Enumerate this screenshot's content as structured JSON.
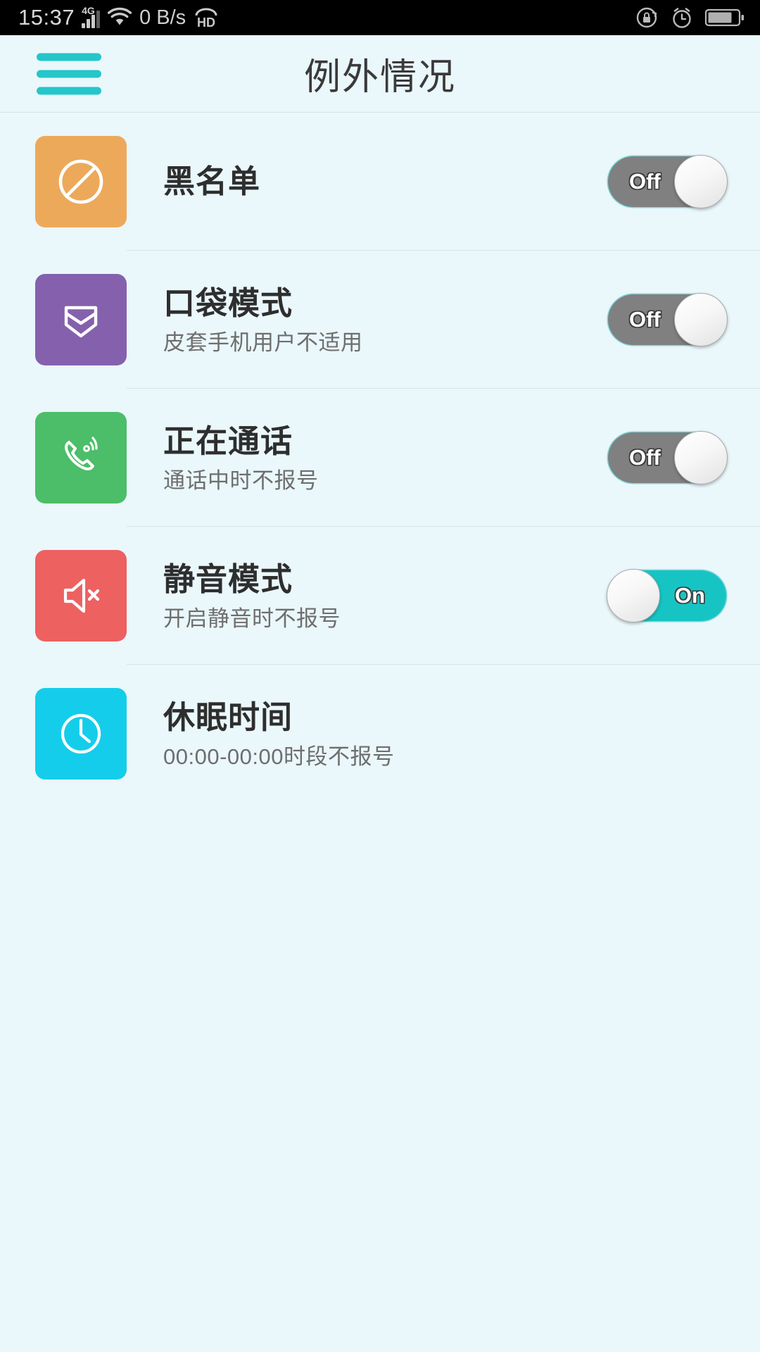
{
  "status_bar": {
    "time": "15:37",
    "network_type": "4G",
    "data_rate": "0 B/s",
    "icons": [
      "signal-icon",
      "wifi-icon",
      "hd-icon",
      "rotation-lock-icon",
      "alarm-icon",
      "battery-icon"
    ],
    "background": "#000000",
    "foreground": "#c8c8c8"
  },
  "header": {
    "menu_label": "menu",
    "title": "例外情况",
    "accent_color": "#24c6c9",
    "background": "#eaf7fb"
  },
  "theme": {
    "page_background": "#eaf7fb",
    "divider": "#d9e3e6",
    "toggle_on": "#17c4c4",
    "toggle_off": "#808080",
    "title_color": "#2e2e2e",
    "subtitle_color": "#6e6e6e"
  },
  "list": {
    "items": [
      {
        "id": "blacklist",
        "title": "黑名单",
        "subtitle": "",
        "icon": "prohibition-icon",
        "icon_color": "#eda95a",
        "has_toggle": true,
        "toggle_state": "off",
        "toggle_label": "Off"
      },
      {
        "id": "pocket-mode",
        "title": "口袋模式",
        "subtitle": "皮套手机用户不适用",
        "icon": "pocket-icon",
        "icon_color": "#8561ad",
        "has_toggle": true,
        "toggle_state": "off",
        "toggle_label": "Off"
      },
      {
        "id": "in-call",
        "title": "正在通话",
        "subtitle": "通话中时不报号",
        "icon": "phone-ringing-icon",
        "icon_color": "#4cbd68",
        "has_toggle": true,
        "toggle_state": "off",
        "toggle_label": "Off"
      },
      {
        "id": "silent-mode",
        "title": "静音模式",
        "subtitle": "开启静音时不报号",
        "icon": "speaker-mute-icon",
        "icon_color": "#ed6161",
        "has_toggle": true,
        "toggle_state": "on",
        "toggle_label": "On"
      },
      {
        "id": "sleep-time",
        "title": "休眠时间",
        "subtitle": "00:00-00:00时段不报号",
        "icon": "clock-icon",
        "icon_color": "#14cdeb",
        "has_toggle": false,
        "toggle_state": "",
        "toggle_label": ""
      }
    ]
  }
}
